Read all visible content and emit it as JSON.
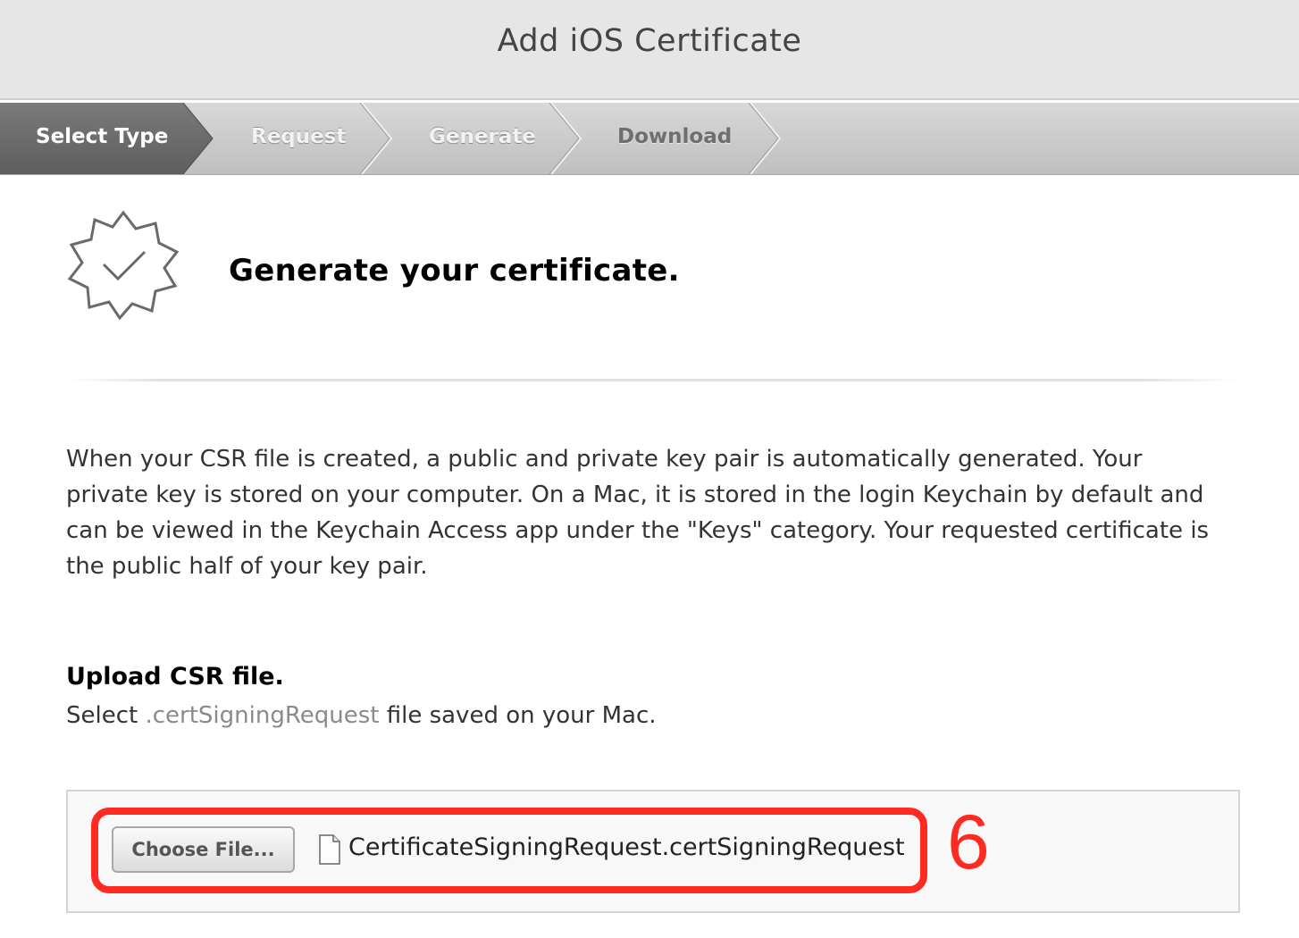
{
  "header": {
    "title": "Add iOS Certificate"
  },
  "steps": [
    {
      "label": "Select Type",
      "state": "active"
    },
    {
      "label": "Request",
      "state": "inactive"
    },
    {
      "label": "Generate",
      "state": "inactive"
    },
    {
      "label": "Download",
      "state": "inactive"
    }
  ],
  "main": {
    "badge_icon": "checkmark-badge-icon",
    "title": "Generate your certificate.",
    "description": "When your CSR file is created, a public and private key pair is automatically generated. Your private key is stored on your computer. On a Mac, it is stored in the login Keychain by default and can be viewed in the Keychain Access app under the \"Keys\" category. Your requested certificate is the public half of your key pair."
  },
  "upload": {
    "title": "Upload CSR file.",
    "desc_prefix": "Select",
    "desc_ext": ".certSigningRequest",
    "desc_suffix": "file saved on your Mac.",
    "choose_button_label": "Choose File...",
    "file_icon": "document-icon",
    "file_name": "CertificateSigningRequest.certSigningRequest"
  },
  "annotation": {
    "number": "6",
    "color": "#ff2a22"
  },
  "colors": {
    "active_step": "#6f6f6f",
    "header_bg": "#e6e6e6",
    "ext_text": "#8a8a8a"
  }
}
